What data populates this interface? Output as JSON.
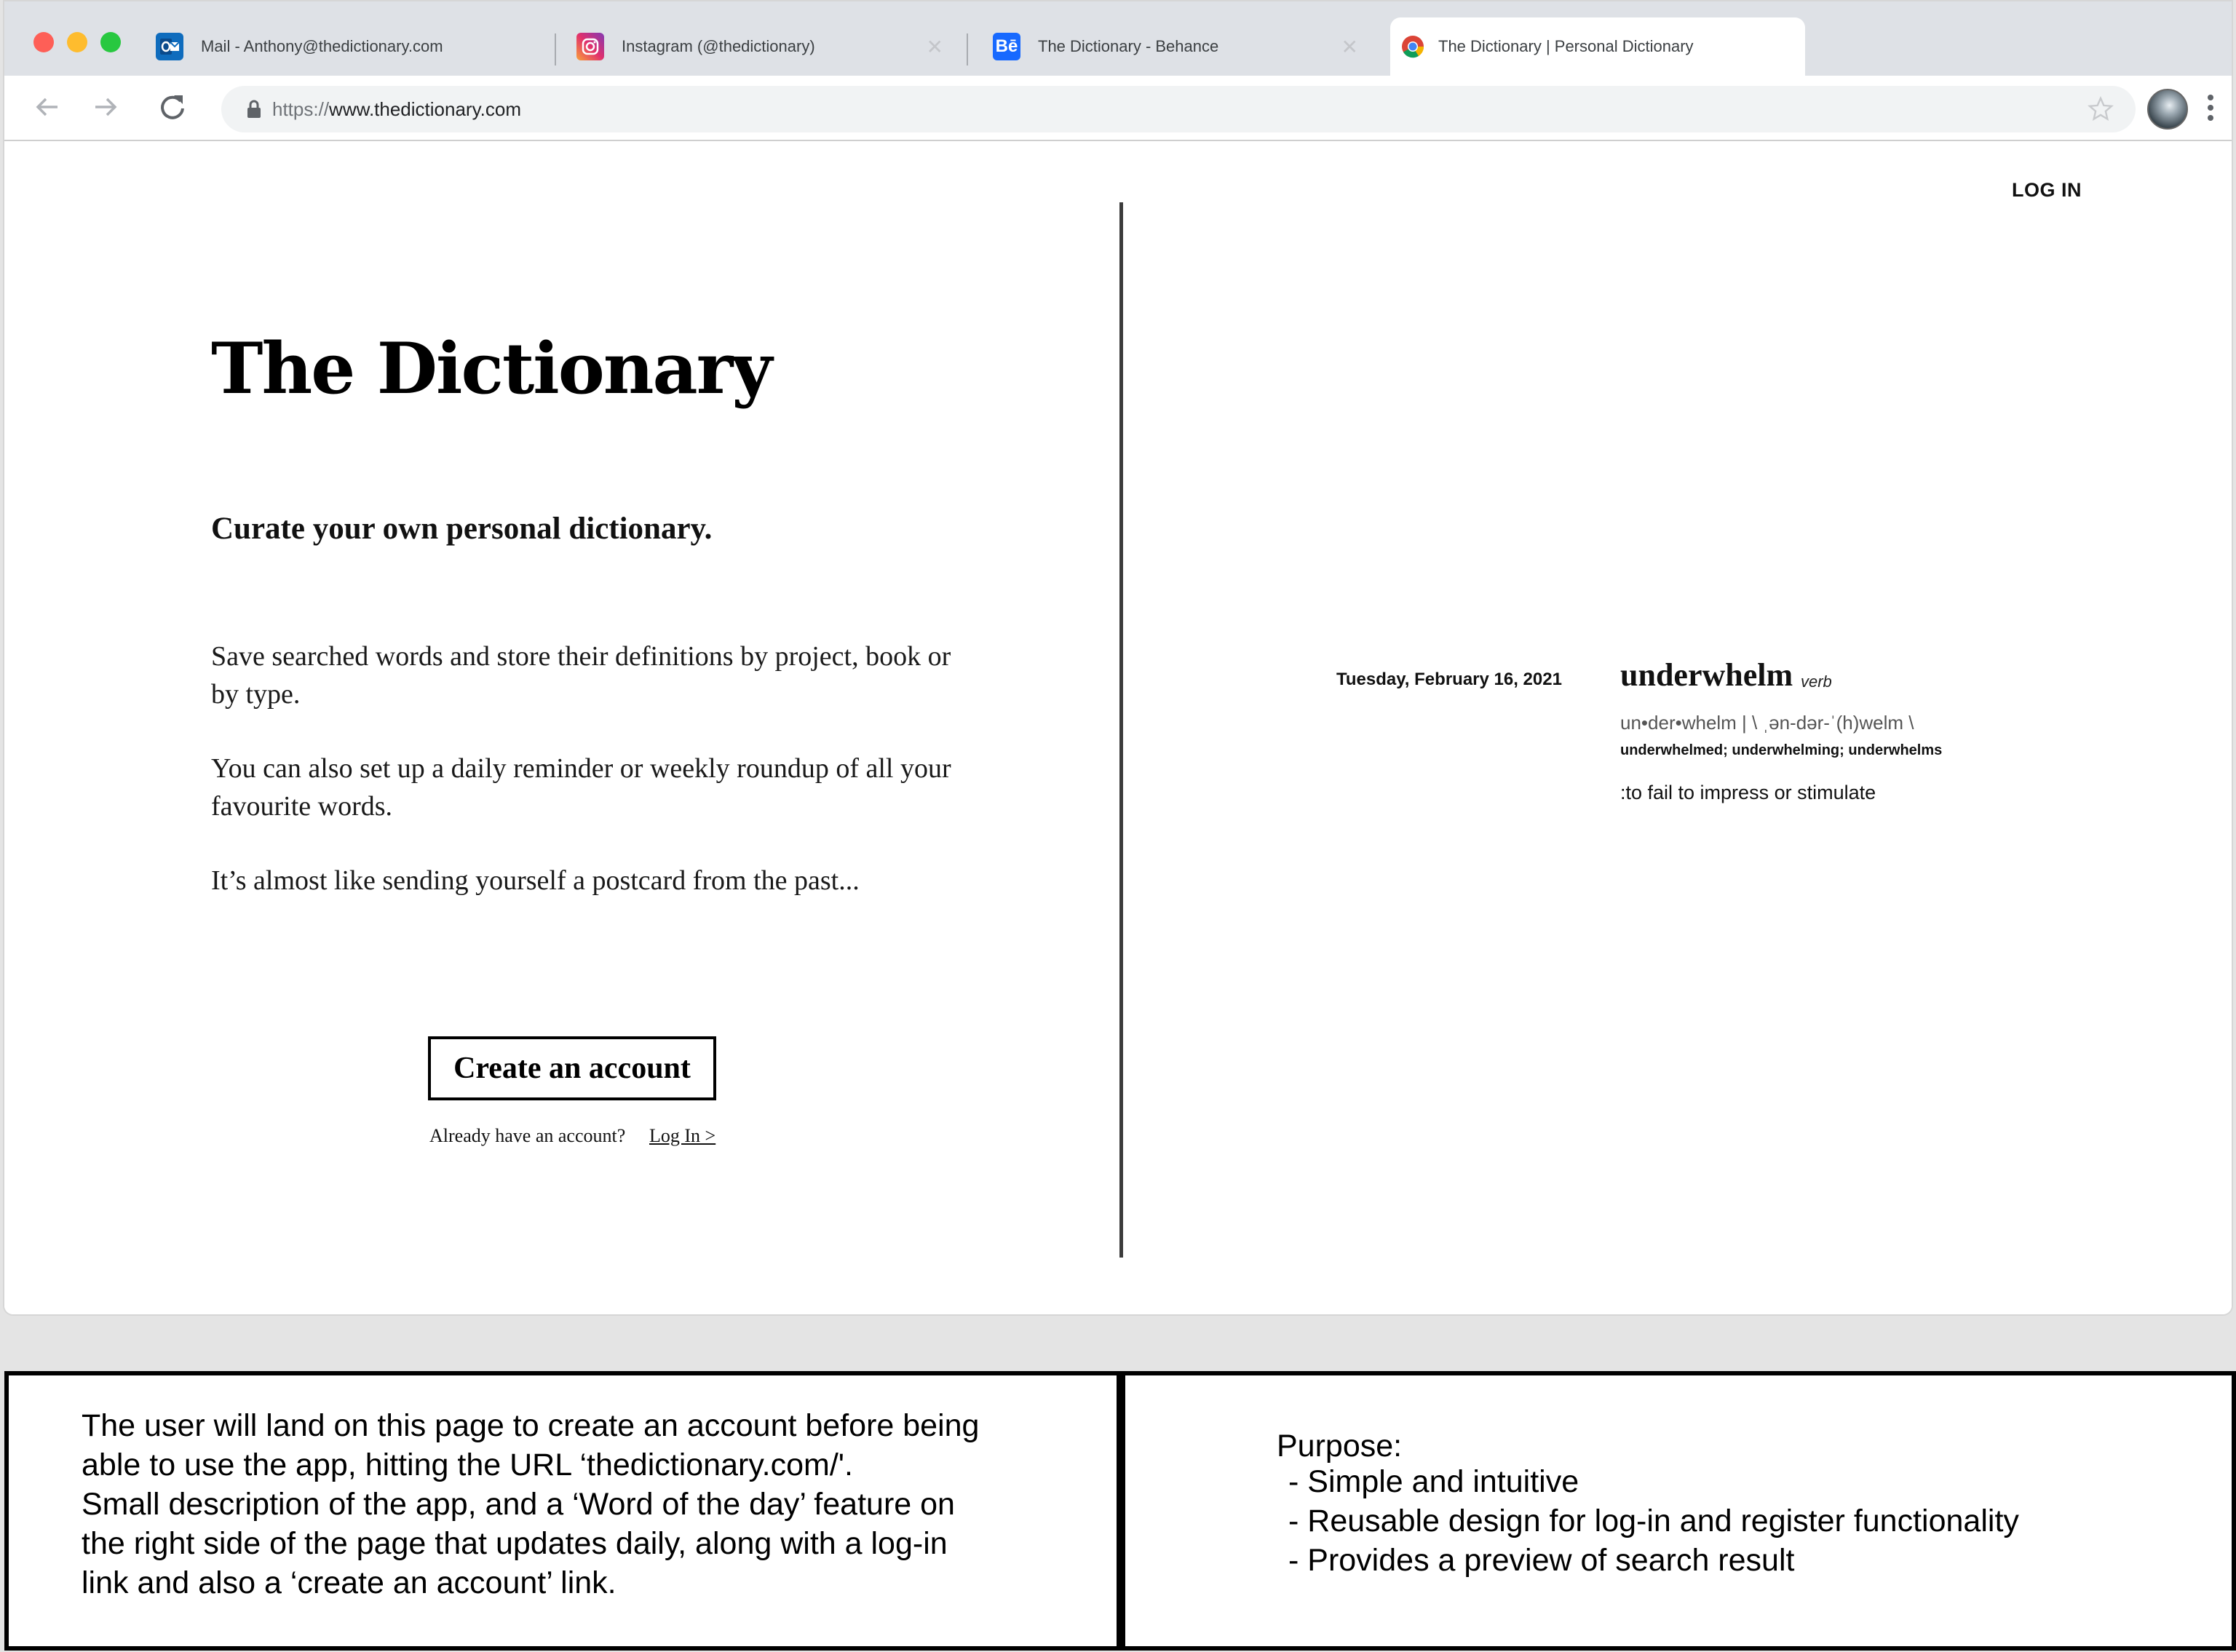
{
  "browser": {
    "tabs": [
      {
        "label": "Mail - Anthony@thedictionary.com",
        "icon": "outlook-icon"
      },
      {
        "label": "Instagram (@thedictionary)",
        "icon": "instagram-icon"
      },
      {
        "label": "The Dictionary - Behance",
        "icon": "behance-icon"
      },
      {
        "label": "The Dictionary | Personal Dictionary",
        "icon": "chrome-icon",
        "active": true
      }
    ],
    "url_scheme": "https://",
    "url_host": "www.thedictionary.com",
    "colors": {
      "close": "#fe5f57",
      "minimize": "#febc2e",
      "maximize": "#28c840"
    }
  },
  "page": {
    "login_link": "LOG IN",
    "title": "The Dictionary",
    "tagline": "Curate your own personal dictionary.",
    "paragraphs": [
      "Save searched words and store their definitions by project, book or by type.",
      "You can also set up a daily reminder or weekly roundup of all your favourite words.",
      "It’s almost like sending yourself a postcard from the past..."
    ],
    "create_button": "Create an account",
    "have_account": "Already have an account?",
    "login_inline": "Log In >"
  },
  "word_of_day": {
    "date": "Tuesday, February 16, 2021",
    "word": "underwhelm",
    "part_of_speech": "verb",
    "pronunciation": "un•der•whelm | \\ ˌən-dər-ˈ(h)welm \\",
    "forms": "underwhelmed; underwhelming; underwhelms",
    "definition": ":to fail to impress or stimulate"
  },
  "notes": {
    "left": [
      "The user will land on this page to create an account before being",
      "able to use the app, hitting the URL ‘thedictionary.com/'.",
      "Small description of the app, and a ‘Word of the day’ feature on",
      "the right side of the page that updates daily, along with a log-in",
      "link and also a ‘create an account’ link."
    ],
    "purpose_title": "Purpose:",
    "purpose_items": [
      "- Simple and intuitive",
      "- Reusable design for log-in and register functionality",
      "- Provides a preview of search result"
    ]
  }
}
